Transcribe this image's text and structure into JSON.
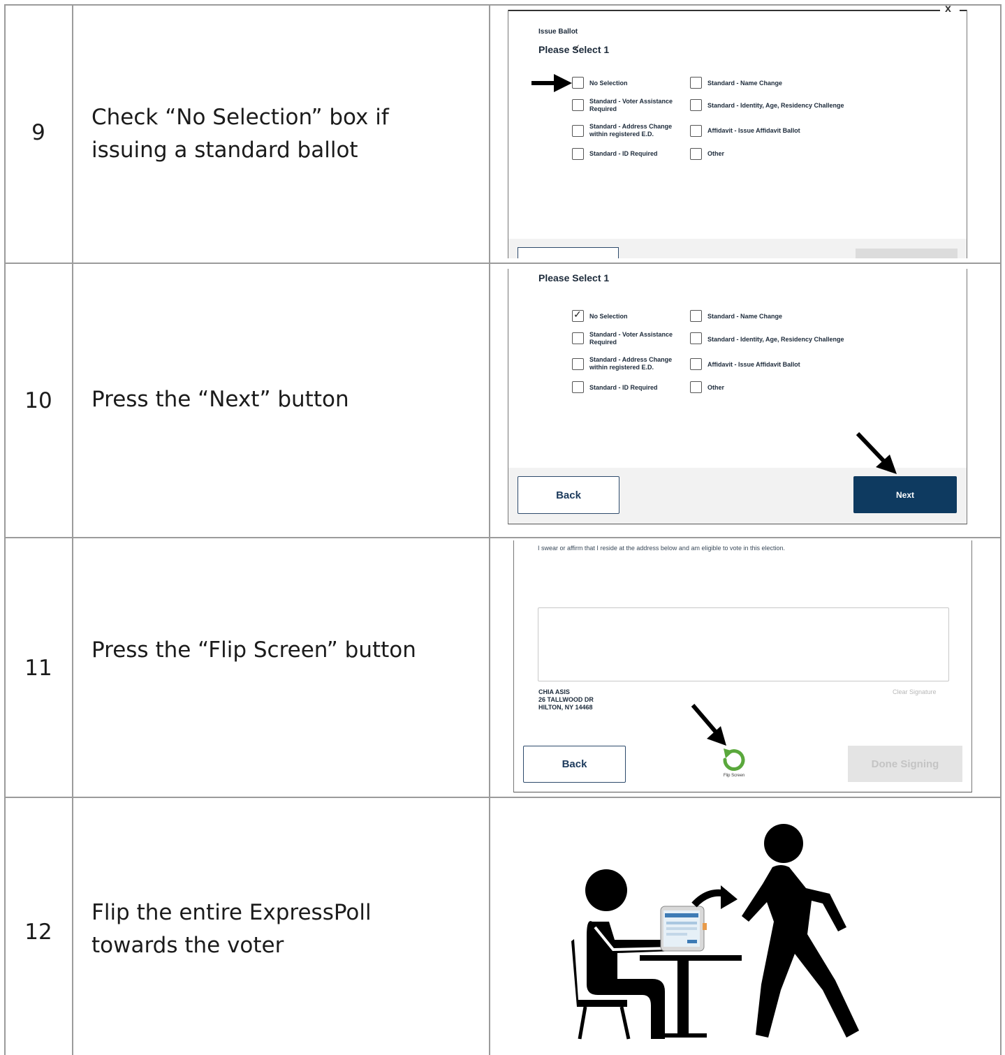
{
  "rows": [
    {
      "number": "9",
      "instruction_line1": "Check “No Selection” box if",
      "instruction_line2": "issuing a standard ballot",
      "screen": {
        "header_small": "Issue Ballot",
        "title": "Please Select 1",
        "options": [
          {
            "label": "No Selection",
            "checked": false
          },
          {
            "label": "Standard - Name Change",
            "checked": false
          },
          {
            "label": "Standard - Voter Assistance\nRequired",
            "checked": false
          },
          {
            "label": "Standard - Identity, Age, Residency Challenge",
            "checked": false
          },
          {
            "label": "Standard - Address Change\nwithin registered E.D.",
            "checked": false
          },
          {
            "label": "Affidavit - Issue Affidavit Ballot",
            "checked": false
          },
          {
            "label": "Standard - ID Required",
            "checked": false
          },
          {
            "label": "Other",
            "checked": false
          }
        ],
        "close_glyph": "x"
      }
    },
    {
      "number": "10",
      "instruction_line1": "Press the “Next” button",
      "screen": {
        "title": "Please Select 1",
        "options": [
          {
            "label": "No Selection",
            "checked": true
          },
          {
            "label": "Standard - Name Change",
            "checked": false
          },
          {
            "label": "Standard - Voter Assistance\nRequired",
            "checked": false
          },
          {
            "label": "Standard - Identity, Age, Residency Challenge",
            "checked": false
          },
          {
            "label": "Standard - Address Change\nwithin registered E.D.",
            "checked": false
          },
          {
            "label": "Affidavit - Issue Affidavit Ballot",
            "checked": false
          },
          {
            "label": "Standard - ID Required",
            "checked": false
          },
          {
            "label": "Other",
            "checked": false
          }
        ],
        "back_label": "Back",
        "next_label": "Next"
      }
    },
    {
      "number": "11",
      "instruction_line1": "Press the “Flip Screen” button",
      "screen": {
        "oath": "I swear or affirm that I reside at the address below and am eligible to vote in this election.",
        "voter_name": "CHIA ASIS",
        "voter_street": "26 TALLWOOD DR",
        "voter_city": "HILTON, NY 14468",
        "clear_signature": "Clear Signature",
        "back_label": "Back",
        "flip_label": "Flip Screen",
        "done_label": "Done Signing"
      }
    },
    {
      "number": "12",
      "instruction_line1": "Flip the entire ExpressPoll",
      "instruction_line2": "towards the voter"
    }
  ],
  "colors": {
    "grid": "#9b9b9b",
    "navy": "#0e3a60",
    "flip_green": "#5aa83c"
  }
}
